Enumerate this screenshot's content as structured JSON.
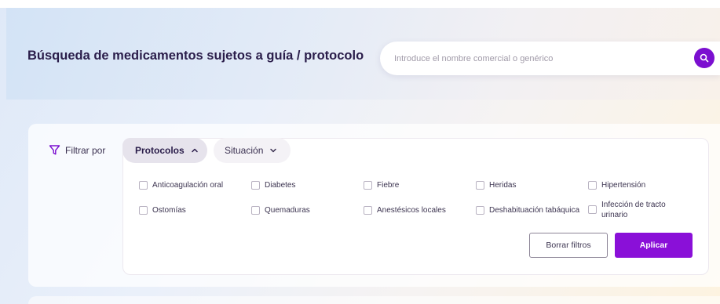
{
  "header": {
    "title": "Búsqueda de medicamentos sujetos a guía / protocolo"
  },
  "search": {
    "placeholder": "Introduce el nombre comercial o genérico",
    "value": "",
    "icon": "search-icon"
  },
  "filters": {
    "label": "Filtrar por",
    "icon": "funnel-icon",
    "tabs": [
      {
        "label": "Protocolos",
        "icon": "chevron-up-icon",
        "active": true
      },
      {
        "label": "Situación",
        "icon": "chevron-down-icon",
        "active": false
      }
    ],
    "options": [
      {
        "label": "Anticoagulación oral",
        "checked": false
      },
      {
        "label": "Diabetes",
        "checked": false
      },
      {
        "label": "Fiebre",
        "checked": false
      },
      {
        "label": "Heridas",
        "checked": false
      },
      {
        "label": "Hipertensión",
        "checked": false
      },
      {
        "label": "Ostomías",
        "checked": false
      },
      {
        "label": "Quemaduras",
        "checked": false
      },
      {
        "label": "Anestésicos locales",
        "checked": false
      },
      {
        "label": "Deshabituación tabáquica",
        "checked": false
      },
      {
        "label": "Infección de tracto urinario",
        "checked": false
      }
    ],
    "clear_label": "Borrar filtros",
    "apply_label": "Aplicar"
  },
  "colors": {
    "accent": "#8a10d8",
    "title": "#2a1d4a"
  }
}
